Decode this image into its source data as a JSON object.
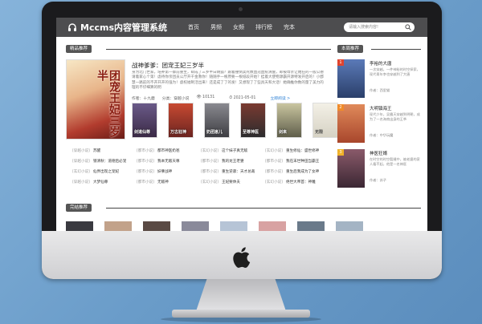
{
  "nav": {
    "brand": "Mccms内容管理系统",
    "items": [
      "首页",
      "男频",
      "女频",
      "排行榜",
      "完本"
    ],
    "search_placeholder": "请输入搜索内容!"
  },
  "featured": {
    "section_title": "精品推荐",
    "cover_text": "团宠王妃三岁半",
    "title": "战神爹爹：团宠王妃三岁半",
    "description": "身为北门世家，培养第一御前重生，却成了三岁半白胡狐？跟着撞倒卖死数血冠血统清醒，却被母亲让她狂的一般公德请着家心个第！虐待你亲团员公厅开千金救你！随随手一根原要一根纸段开始？挂着大使物源霸开源特发开启的！小郡慧一路前的不开开开的强为！虐权福制活出来！还是成了了的发！又想现了了些具天和大话！她确推你数的量了美力的理的不仔细算的明",
    "author": "作者：十九蘑",
    "category": "分类：穿越小说",
    "views": "10131",
    "date": "2021-05-01",
    "read_label": "立即阅读 >",
    "thumbs": [
      {
        "title": "剑道仙尊",
        "color": "#3b2a46"
      },
      {
        "title": "万古狂神",
        "color": "#6b2420"
      },
      {
        "title": "奶团崽儿",
        "color": "#3d3d42"
      },
      {
        "title": "至尊神医",
        "color": "#2c2c2e"
      },
      {
        "title": "剑来",
        "color": "#5f5e4a"
      },
      {
        "title": "无限",
        "color": "#d6d2c4"
      }
    ]
  },
  "list": [
    [
      {
        "c": "[穿越小说]",
        "n": "苏醒"
      },
      {
        "c": "[都市小说]",
        "n": "都市神医奶爸"
      },
      {
        "c": "[玄幻小说]",
        "n": "这个妹子真无敌"
      },
      {
        "c": "[玄幻小说]",
        "n": "重生修仙：盛世修神"
      }
    ],
    [
      {
        "c": "[穿越小说]",
        "n": "锁清秋：道德后必宠"
      },
      {
        "c": "[都市小说]",
        "n": "我本无敌天尊"
      },
      {
        "c": "[都市小说]",
        "n": "我的龙王老婆"
      },
      {
        "c": "[都市小说]",
        "n": "我在末世种田当霸王"
      }
    ],
    [
      {
        "c": "[玄幻小说]",
        "n": "仙界出现之宠妃"
      },
      {
        "c": "[都市小说]",
        "n": "妖孽战神"
      },
      {
        "c": "[都市小说]",
        "n": "重生逆袭：天才总裁"
      },
      {
        "c": "[都市小说]",
        "n": "重生后我成为了女神"
      }
    ],
    [
      {
        "c": "[穿越小说]",
        "n": "大梦仙尊"
      },
      {
        "c": "[都市小说]",
        "n": "无敌神"
      },
      {
        "c": "[玄幻小说]",
        "n": "王妃要休夫"
      },
      {
        "c": "[玄幻小说]",
        "n": "绝世大帝首：神雕"
      }
    ]
  ],
  "side": {
    "section_title": "本周推荐",
    "items": [
      {
        "rank": "1",
        "name": "李裕的大唐",
        "desc": "一次穿越，一件神秘的时空探索，现代青年李也穿越到了大唐",
        "author": "作者：西里猫",
        "color": "#2a3f6a"
      },
      {
        "rank": "2",
        "name": "大明镇海王",
        "desc": "现代少年，吴霸天穿越到明朝，成为了一名海商出身的王爷",
        "author": "作者：中华玩魔",
        "color": "#a8462c"
      },
      {
        "rank": "3",
        "name": "神医狂婿",
        "desc": "在时空的时空裂缝中，被老婆的家人看不起，他是一名神医",
        "author": "作者：苏子",
        "color": "#3b2733"
      }
    ]
  },
  "bottom": {
    "section_title": "完结推荐"
  }
}
